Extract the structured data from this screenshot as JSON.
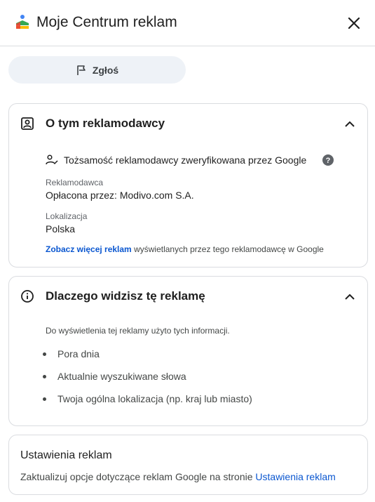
{
  "header": {
    "title": "Moje Centrum reklam",
    "logo_icon": "my-ad-center-logo",
    "close_icon": "close-icon"
  },
  "report_button": {
    "label": "Zgłoś",
    "icon": "flag-icon"
  },
  "advertiser_section": {
    "title": "O tym reklamodawcy",
    "icon": "portrait-icon",
    "verified_text": "Tożsamość reklamodawcy zweryfikowana przez Google",
    "advertiser_label": "Reklamodawca",
    "advertiser_value": "Opłacona przez: Modivo.com S.A.",
    "location_label": "Lokalizacja",
    "location_value": "Polska",
    "more_link": "Zobacz więcej reklam",
    "more_suffix": " wyświetlanych przez tego reklamodawcę w Google"
  },
  "why_section": {
    "title": "Dlaczego widzisz tę reklamę",
    "icon": "info-icon",
    "intro": "Do wyświetlenia tej reklamy użyto tych informacji.",
    "reasons": [
      "Pora dnia",
      "Aktualnie wyszukiwane słowa",
      "Twoja ogólna lokalizacja (np. kraj lub miasto)"
    ]
  },
  "settings_section": {
    "title": "Ustawienia reklam",
    "text": "Zaktualizuj opcje dotyczące reklam Google na stronie ",
    "link": "Ustawienia reklam"
  },
  "colors": {
    "accent": "#0b57d0",
    "border": "#dadce0",
    "button_bg": "#eef2f7"
  }
}
